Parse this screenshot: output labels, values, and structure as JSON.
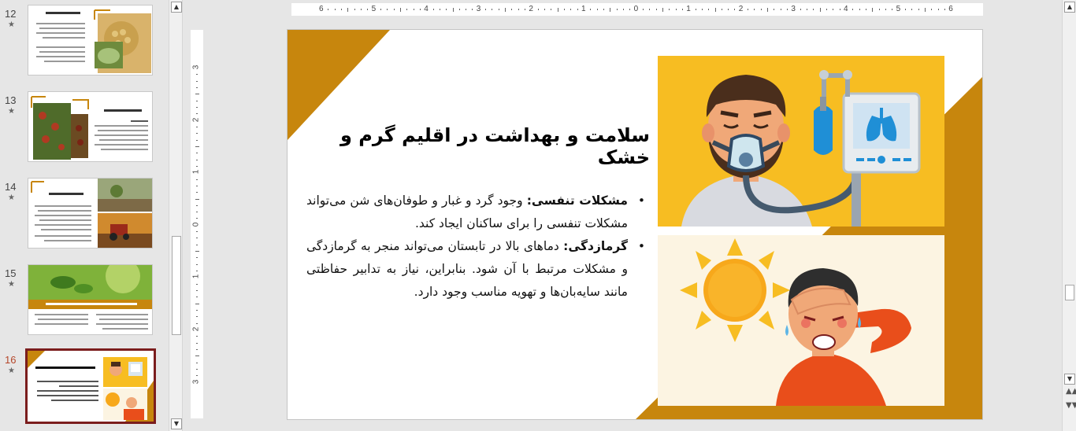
{
  "thumbnails": [
    {
      "number": "12",
      "title": "محصولات قابل کشت",
      "active": false
    },
    {
      "number": "13",
      "title": "محصولات قابل کشت",
      "active": false
    },
    {
      "number": "14",
      "title": "تکنیک‌های کشاورزی",
      "active": false
    },
    {
      "number": "15",
      "title": "گیاهان مناسب برای کاهش تعرق در مناطق گرم و خشک",
      "active": false
    },
    {
      "number": "16",
      "title": "سلامت و بهداشت در اقلیم گرم و خشک",
      "active": true
    }
  ],
  "thumb_star": "★",
  "ruler": {
    "h_labels": [
      "6",
      "5",
      "4",
      "3",
      "2",
      "1",
      "0",
      "1",
      "2",
      "3",
      "4",
      "5",
      "6"
    ],
    "v_labels": [
      "3",
      "2",
      "1",
      "0",
      "1",
      "2",
      "3"
    ]
  },
  "slide": {
    "title": "سلامت و بهداشت در اقلیم گرم و خشک",
    "bullets": [
      {
        "bold": "مشکلات تنفسی:",
        "text": " وجود گرد و غبار و طوفان‌های شن می‌تواند مشکلات تنفسی را برای ساکنان ایجاد کند."
      },
      {
        "bold": "گرمازدگی:",
        "text": " دماهای بالا در تابستان می‌تواند منجر به گرمازدگی و مشکلات مرتبط با آن شود. بنابراین، نیاز به تدابیر حفاظتی مانند سایه‌بان‌ها و تهویه مناسب وجود دارد."
      }
    ],
    "bullet_char": "•"
  },
  "colors": {
    "accent_gold": "#c7860d",
    "panel_yellow": "#f7bd22",
    "panel_cream": "#fcf4e2",
    "active_border": "#7b1d1d"
  },
  "icons": {
    "scroll_up": "▲",
    "scroll_down": "▼",
    "prev_slide": "▲▲",
    "next_slide": "▼▼"
  }
}
